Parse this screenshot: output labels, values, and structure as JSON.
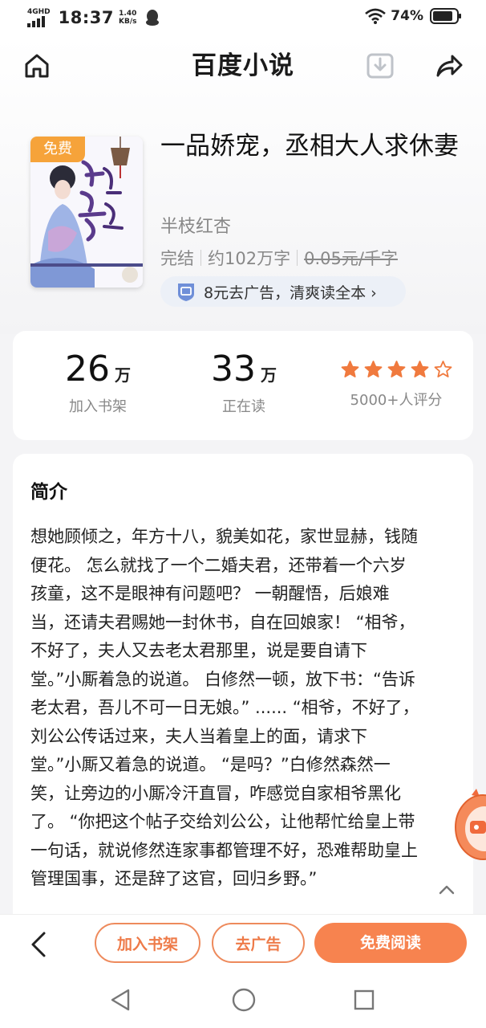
{
  "status_bar": {
    "network": "4GHD",
    "time": "18:37",
    "speed_value": "1.40",
    "speed_unit": "KB/s",
    "battery": "74%"
  },
  "nav": {
    "title": "百度小说"
  },
  "book": {
    "free_tag": "免费",
    "title": "一品娇宠，丞相大人求休妻",
    "author": "半枝红杏",
    "status": "完结",
    "word_count": "约102万字",
    "price": "0.05元/千字",
    "ad_offer": "8元去广告，清爽读全本 ›"
  },
  "stats": {
    "bookshelf": {
      "num": "26",
      "unit": "万",
      "label": "加入书架"
    },
    "reading": {
      "num": "33",
      "unit": "万",
      "label": "正在读"
    },
    "rating": {
      "stars_filled": 4,
      "stars_total": 5,
      "label": "5000+人评分"
    }
  },
  "intro": {
    "title": "简介",
    "lines": [
      "想她顾倾之，年方十八，貌美如花，家世显赫，钱随",
      "便花。 怎么就找了一个二婚夫君，还带着一个六岁",
      "孩童，这不是眼神有问题吧？ 一朝醒悟，后娘难",
      "当，还请夫君赐她一封休书，自在回娘家！ “相爷，",
      "不好了，夫人又去老太君那里，说是要自请下",
      "堂。”小厮着急的说道。 白修然一顿，放下书：“告诉",
      "老太君，吾儿不可一日无娘。” ...... “相爷，不好了，",
      "刘公公传话过来，夫人当着皇上的面，请求下",
      "堂。”小厮又着急的说道。 “是吗？”白修然森然一",
      "笑，让旁边的小厮冷汗直冒，咋感觉自家相爷黑化",
      "了。 “你把这个帖子交给刘公公，让他帮忙给皇上带",
      "一句话，就说修然连家事都管理不好，恐难帮助皇上",
      "管理国事，还是辞了这官，回归乡野。”"
    ]
  },
  "bottom": {
    "add_shelf": "加入书架",
    "remove_ad": "去广告",
    "read_free": "免费阅读"
  },
  "colors": {
    "accent": "#f7834f",
    "star": "#f07a3e",
    "free_tag": "#f6a33a"
  }
}
